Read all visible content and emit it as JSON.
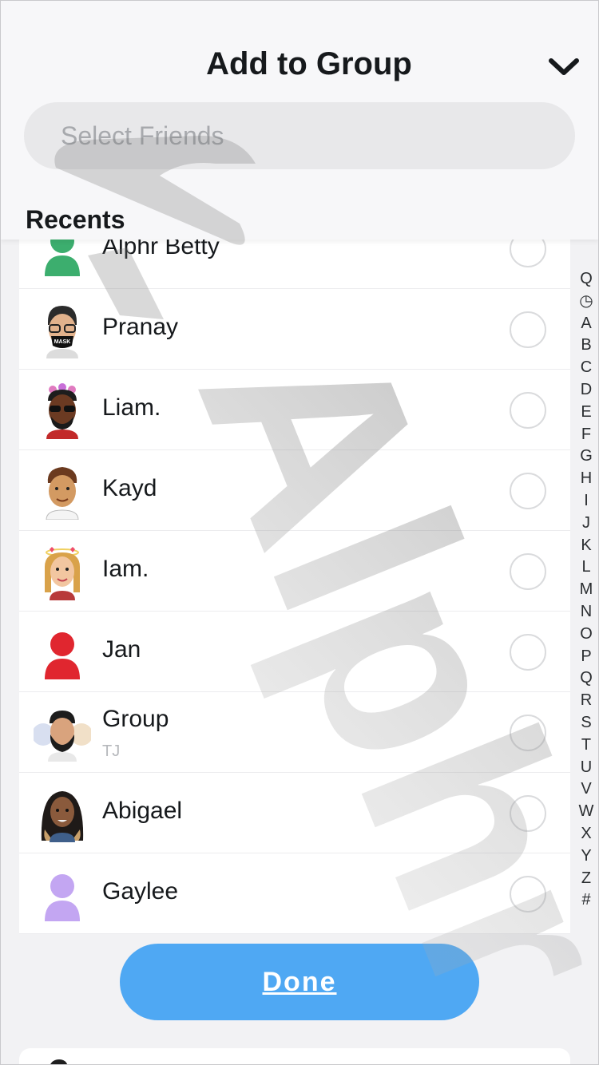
{
  "header": {
    "title": "Add to Group",
    "collapse_icon": "chevron-down-icon"
  },
  "search": {
    "placeholder": "Select Friends",
    "icon": "search-icon"
  },
  "section": {
    "title": "Recents"
  },
  "friends": [
    {
      "name": "Alphr Betty",
      "subtitle": "",
      "avatar": "silhouette-avatar",
      "color": "#3cae6e"
    },
    {
      "name": "Pranay",
      "subtitle": "",
      "avatar": "bitmoji-avatar",
      "color": "#2b2b2b"
    },
    {
      "name": "Liam.",
      "subtitle": "",
      "avatar": "bitmoji-avatar",
      "color": "#6b3a22"
    },
    {
      "name": "Kayd",
      "subtitle": "",
      "avatar": "bitmoji-avatar",
      "color": "#d39a62"
    },
    {
      "name": "Iam.",
      "subtitle": "",
      "avatar": "bitmoji-avatar",
      "color": "#f2c6a0"
    },
    {
      "name": "Jan",
      "subtitle": "",
      "avatar": "silhouette-avatar",
      "color": "#e0262f"
    },
    {
      "name": "Group",
      "subtitle": "TJ",
      "avatar": "group-avatar",
      "color": "#1c1c1c"
    },
    {
      "name": "Abigael",
      "subtitle": "",
      "avatar": "bitmoji-avatar",
      "color": "#8a5a3c"
    },
    {
      "name": "Gaylee",
      "subtitle": "",
      "avatar": "silhouette-avatar",
      "color": "#c3a6f2"
    }
  ],
  "alpha_index": [
    "Q",
    "◷",
    "A",
    "B",
    "C",
    "D",
    "E",
    "F",
    "G",
    "H",
    "I",
    "J",
    "K",
    "L",
    "M",
    "N",
    "O",
    "P",
    "Q",
    "R",
    "S",
    "T",
    "U",
    "V",
    "W",
    "X",
    "Y",
    "Z",
    "#"
  ],
  "done": {
    "label": "Done"
  },
  "watermark": {
    "text": "Alphr"
  },
  "colors": {
    "accent": "#4fa8f3",
    "background": "#f2f2f4",
    "text": "#16191c",
    "placeholder": "#a7a9ad"
  }
}
